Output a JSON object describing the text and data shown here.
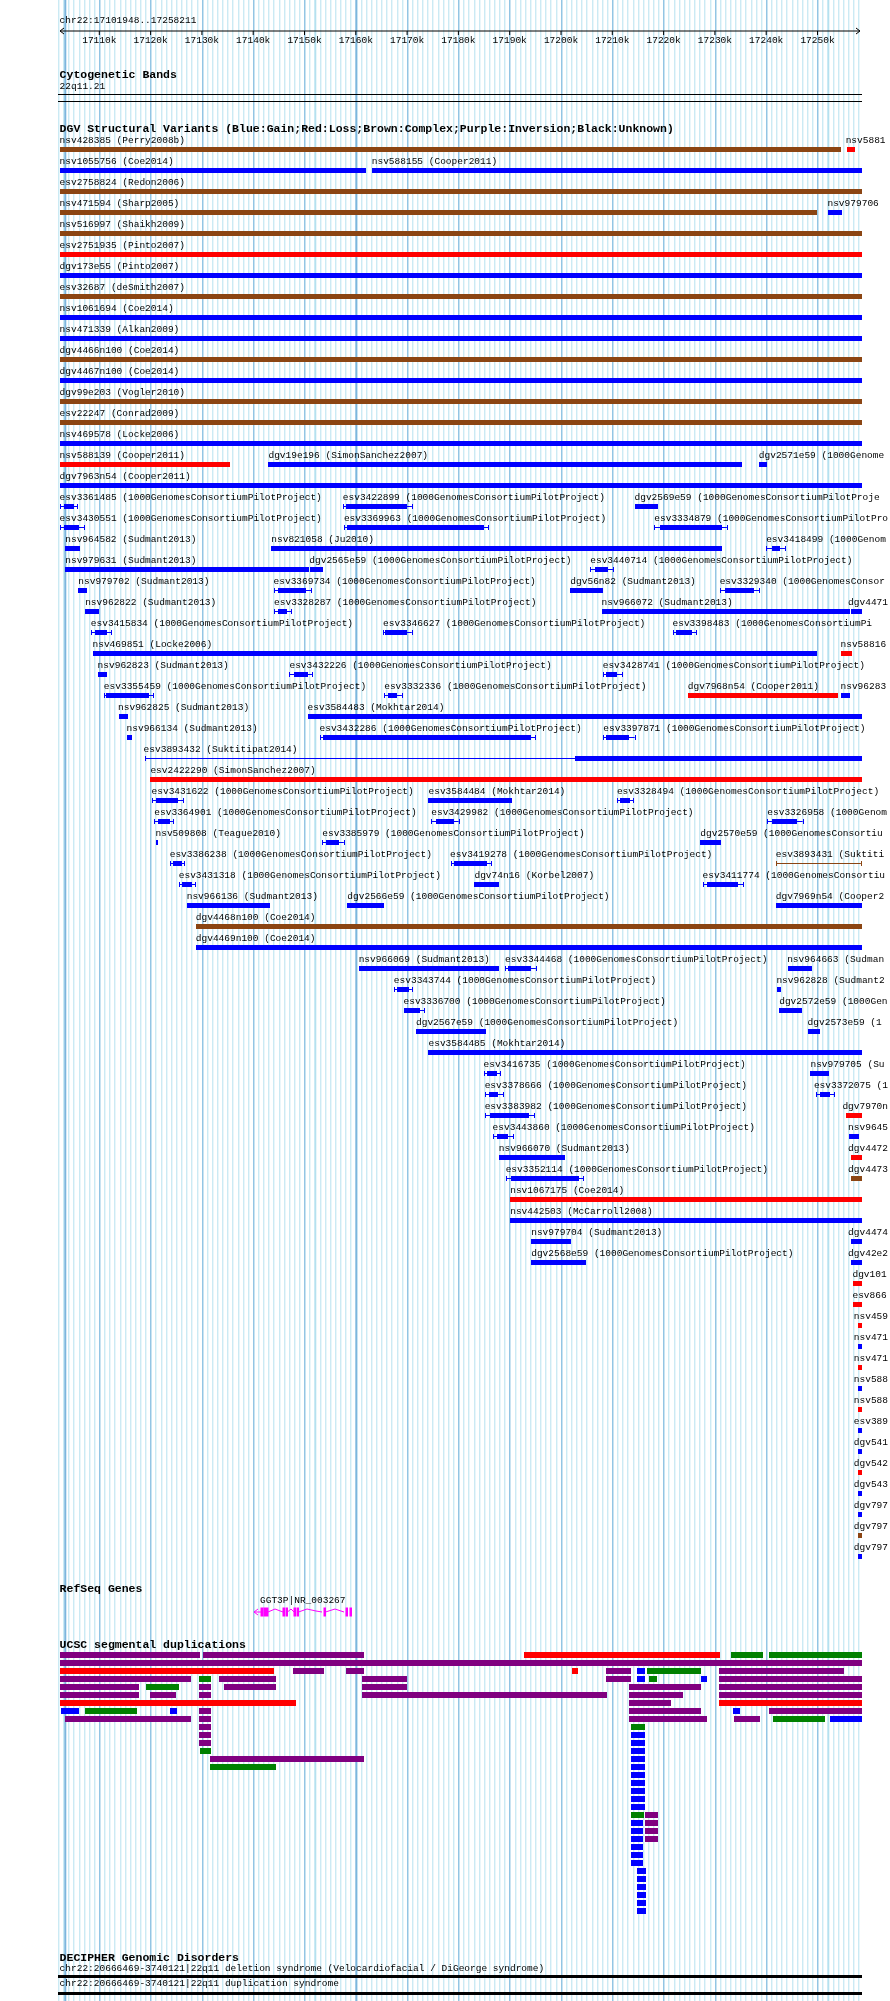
{
  "ruler": {
    "position": "chr22:17101948..17258211",
    "ticks": [
      "17110k",
      "17120k",
      "17130k",
      "17140k",
      "17150k",
      "17160k",
      "17170k",
      "17180k",
      "17190k",
      "17200k",
      "17210k",
      "17220k",
      "17230k",
      "17240k",
      "17250k"
    ]
  },
  "cytogenetic_bands": {
    "title": "Cytogenetic Bands",
    "band": "22q11.21"
  },
  "dgv": {
    "title": "DGV Structural Variants (Blue:Gain;Red:Loss;Brown:Complex;Purple:Inversion;Black:Unknown)",
    "rows": [
      [
        {
          "label": "nsv428385 (Perry2008b)",
          "color": "#8b4513",
          "kind": "bar"
        },
        {
          "label": "nsv5881",
          "color": "#ff0000",
          "kind": "bar"
        }
      ],
      [
        {
          "label": "nsv1055756 (Coe2014)",
          "color": "#0000ff",
          "kind": "bar"
        },
        {
          "label": "nsv588155 (Cooper2011)",
          "color": "#0000ff",
          "kind": "bar"
        }
      ],
      [
        {
          "label": "esv2758824 (Redon2006)",
          "color": "#8b4513",
          "kind": "bar"
        }
      ],
      [
        {
          "label": "nsv471594 (Sharp2005)",
          "color": "#8b4513",
          "kind": "bar"
        },
        {
          "label": "nsv979706",
          "color": "#0000ff",
          "kind": "bar"
        }
      ],
      [
        {
          "label": "nsv516997 (Shaikh2009)",
          "color": "#8b4513",
          "kind": "bar"
        }
      ],
      [
        {
          "label": "esv2751935 (Pinto2007)",
          "color": "#ff0000",
          "kind": "bar"
        }
      ],
      [
        {
          "label": "dgv173e55 (Pinto2007)",
          "color": "#0000ff",
          "kind": "bar"
        }
      ],
      [
        {
          "label": "esv32687 (deSmith2007)",
          "color": "#8b4513",
          "kind": "bar"
        }
      ],
      [
        {
          "label": "nsv1061694 (Coe2014)",
          "color": "#0000ff",
          "kind": "bar"
        }
      ],
      [
        {
          "label": "nsv471339 (Alkan2009)",
          "color": "#0000ff",
          "kind": "bar"
        }
      ],
      [
        {
          "label": "dgv4466n100 (Coe2014)",
          "color": "#8b4513",
          "kind": "bar"
        }
      ],
      [
        {
          "label": "dgv4467n100 (Coe2014)",
          "color": "#0000ff",
          "kind": "bar"
        }
      ],
      [
        {
          "label": "dgv99e203 (Vogler2010)",
          "color": "#8b4513",
          "kind": "bar"
        }
      ],
      [
        {
          "label": "esv22247 (Conrad2009)",
          "color": "#8b4513",
          "kind": "bar"
        }
      ],
      [
        {
          "label": "nsv469578 (Locke2006)",
          "color": "#0000ff",
          "kind": "bar"
        }
      ],
      [
        {
          "label": "nsv588139 (Cooper2011)",
          "color": "#ff0000",
          "kind": "bar"
        },
        {
          "label": "dgv19e196 (SimonSanchez2007)",
          "color": "#0000ff",
          "kind": "bar"
        },
        {
          "label": "dgv2571e59 (1000Genome",
          "color": "#0000ff",
          "kind": "bar"
        }
      ],
      [
        {
          "label": "dgv7963n54 (Cooper2011)",
          "color": "#0000ff",
          "kind": "bar"
        }
      ],
      [
        {
          "label": "esv3361485 (1000GenomesConsortiumPilotProject)",
          "color": "#0000ff",
          "kind": "span"
        },
        {
          "label": "esv3422899 (1000GenomesConsortiumPilotProject)",
          "color": "#0000ff",
          "kind": "span"
        },
        {
          "label": "dgv2569e59 (1000GenomesConsortiumPilotProje",
          "color": "#0000ff",
          "kind": "bar"
        }
      ],
      [
        {
          "label": "esv3430551 (1000GenomesConsortiumPilotProject)",
          "color": "#0000ff",
          "kind": "span"
        },
        {
          "label": "esv3369963 (1000GenomesConsortiumPilotProject)",
          "color": "#0000ff",
          "kind": "span"
        },
        {
          "label": "esv3334879 (1000GenomesConsortiumPilotPro",
          "color": "#0000ff",
          "kind": "span"
        }
      ],
      [
        {
          "label": "nsv964582 (Sudmant2013)",
          "color": "#0000ff",
          "kind": "bar"
        },
        {
          "label": "nsv821058 (Ju2010)",
          "color": "#0000ff",
          "kind": "bar"
        },
        {
          "label": "esv3418499 (1000Genom",
          "color": "#0000ff",
          "kind": "span"
        }
      ],
      [
        {
          "label": "nsv979631 (Sudmant2013)",
          "color": "#0000ff",
          "kind": "bar"
        },
        {
          "label": "dgv2565e59 (1000GenomesConsortiumPilotProject)",
          "color": "#0000ff",
          "kind": "bar"
        },
        {
          "label": "esv3440714 (1000GenomesConsortiumPilotProject)",
          "color": "#0000ff",
          "kind": "span"
        }
      ],
      [
        {
          "label": "nsv979702 (Sudmant2013)",
          "color": "#0000ff",
          "kind": "bar"
        },
        {
          "label": "esv3369734 (1000GenomesConsortiumPilotProject)",
          "color": "#0000ff",
          "kind": "span"
        },
        {
          "label": "dgv56n82 (Sudmant2013)",
          "color": "#0000ff",
          "kind": "bar"
        },
        {
          "label": "esv3329340 (1000GenomesConsor",
          "color": "#0000ff",
          "kind": "span"
        }
      ],
      [
        {
          "label": "nsv962822 (Sudmant2013)",
          "color": "#0000ff",
          "kind": "bar"
        },
        {
          "label": "esv3328287 (1000GenomesConsortiumPilotProject)",
          "color": "#0000ff",
          "kind": "span"
        },
        {
          "label": "nsv966072 (Sudmant2013)",
          "color": "#0000ff",
          "kind": "bar"
        },
        {
          "label": "dgv4471",
          "color": "#0000ff",
          "kind": "bar"
        }
      ],
      [
        {
          "label": "esv3415834 (1000GenomesConsortiumPilotProject)",
          "color": "#0000ff",
          "kind": "span"
        },
        {
          "label": "esv3346627 (1000GenomesConsortiumPilotProject)",
          "color": "#0000ff",
          "kind": "span"
        },
        {
          "label": "esv3398483 (1000GenomesConsortiumPi",
          "color": "#0000ff",
          "kind": "span"
        }
      ],
      [
        {
          "label": "nsv469851 (Locke2006)",
          "color": "#0000ff",
          "kind": "bar"
        },
        {
          "label": "nsv58816",
          "color": "#ff0000",
          "kind": "bar"
        }
      ],
      [
        {
          "label": "nsv962823 (Sudmant2013)",
          "color": "#0000ff",
          "kind": "bar"
        },
        {
          "label": "esv3432226 (1000GenomesConsortiumPilotProject)",
          "color": "#0000ff",
          "kind": "span"
        },
        {
          "label": "esv3428741 (1000GenomesConsortiumPilotProject)",
          "color": "#0000ff",
          "kind": "span"
        }
      ],
      [
        {
          "label": "esv3355459 (1000GenomesConsortiumPilotProject)",
          "color": "#0000ff",
          "kind": "span"
        },
        {
          "label": "esv3332336 (1000GenomesConsortiumPilotProject)",
          "color": "#0000ff",
          "kind": "span"
        },
        {
          "label": "dgv7968n54 (Cooper2011)",
          "color": "#ff0000",
          "kind": "bar"
        },
        {
          "label": "nsv96283",
          "color": "#0000ff",
          "kind": "bar"
        }
      ],
      [
        {
          "label": "nsv962825 (Sudmant2013)",
          "color": "#0000ff",
          "kind": "bar"
        },
        {
          "label": "esv3584483 (Mokhtar2014)",
          "color": "#0000ff",
          "kind": "bar"
        }
      ],
      [
        {
          "label": "nsv966134 (Sudmant2013)",
          "color": "#0000ff",
          "kind": "bar"
        },
        {
          "label": "esv3432286 (1000GenomesConsortiumPilotProject)",
          "color": "#0000ff",
          "kind": "span"
        },
        {
          "label": "esv3397871 (1000GenomesConsortiumPilotProject)",
          "color": "#0000ff",
          "kind": "span"
        }
      ],
      [
        {
          "label": "esv3893432 (Suktitipat2014)",
          "color": "#0000ff",
          "kind": "span"
        }
      ],
      [
        {
          "label": "esv2422290 (SimonSanchez2007)",
          "color": "#ff0000",
          "kind": "bar"
        }
      ],
      [
        {
          "label": "esv3431622 (1000GenomesConsortiumPilotProject)",
          "color": "#0000ff",
          "kind": "span"
        },
        {
          "label": "esv3584484 (Mokhtar2014)",
          "color": "#0000ff",
          "kind": "bar"
        },
        {
          "label": "esv3328494 (1000GenomesConsortiumPilotProject)",
          "color": "#0000ff",
          "kind": "span"
        }
      ],
      [
        {
          "label": "esv3364901 (1000GenomesConsortiumPilotProject)",
          "color": "#0000ff",
          "kind": "span"
        },
        {
          "label": "esv3429982 (1000GenomesConsortiumPilotProject)",
          "color": "#0000ff",
          "kind": "span"
        },
        {
          "label": "esv3326958 (1000Genom",
          "color": "#0000ff",
          "kind": "span"
        }
      ],
      [
        {
          "label": "nsv509808 (Teague2010)",
          "color": "#0000ff",
          "kind": "bar"
        },
        {
          "label": "esv3385979 (1000GenomesConsortiumPilotProject)",
          "color": "#0000ff",
          "kind": "span"
        },
        {
          "label": "dgv2570e59 (1000GenomesConsortiu",
          "color": "#0000ff",
          "kind": "bar"
        }
      ],
      [
        {
          "label": "esv3386238 (1000GenomesConsortiumPilotProject)",
          "color": "#0000ff",
          "kind": "span"
        },
        {
          "label": "esv3419278 (1000GenomesConsortiumPilotProject)",
          "color": "#0000ff",
          "kind": "span"
        },
        {
          "label": "esv3893431 (Suktiti",
          "color": "#8b4513",
          "kind": "span"
        }
      ],
      [
        {
          "label": "esv3431318 (1000GenomesConsortiumPilotProject)",
          "color": "#0000ff",
          "kind": "span"
        },
        {
          "label": "dgv74n16 (Korbel2007)",
          "color": "#0000ff",
          "kind": "bar"
        },
        {
          "label": "esv3411774 (1000GenomesConsortiu",
          "color": "#0000ff",
          "kind": "span"
        }
      ],
      [
        {
          "label": "nsv966136 (Sudmant2013)",
          "color": "#0000ff",
          "kind": "bar"
        },
        {
          "label": "dgv2566e59 (1000GenomesConsortiumPilotProject)",
          "color": "#0000ff",
          "kind": "bar"
        },
        {
          "label": "dgv7969n54 (Cooper2",
          "color": "#0000ff",
          "kind": "bar"
        }
      ],
      [
        {
          "label": "dgv4468n100 (Coe2014)",
          "color": "#8b4513",
          "kind": "bar"
        }
      ],
      [
        {
          "label": "dgv4469n100 (Coe2014)",
          "color": "#0000ff",
          "kind": "bar"
        }
      ],
      [
        {
          "label": "nsv966069 (Sudmant2013)",
          "color": "#0000ff",
          "kind": "bar"
        },
        {
          "label": "esv3344468 (1000GenomesConsortiumPilotProject)",
          "color": "#0000ff",
          "kind": "span"
        },
        {
          "label": "nsv964663 (Sudman",
          "color": "#0000ff",
          "kind": "bar"
        }
      ],
      [
        {
          "label": "esv3343744 (1000GenomesConsortiumPilotProject)",
          "color": "#0000ff",
          "kind": "span"
        },
        {
          "label": "nsv962828 (Sudmant2",
          "color": "#0000ff",
          "kind": "bar"
        }
      ],
      [
        {
          "label": "esv3336700 (1000GenomesConsortiumPilotProject)",
          "color": "#0000ff",
          "kind": "span"
        },
        {
          "label": "dgv2572e59 (1000Gen",
          "color": "#0000ff",
          "kind": "bar"
        }
      ],
      [
        {
          "label": "dgv2567e59 (1000GenomesConsortiumPilotProject)",
          "color": "#0000ff",
          "kind": "bar"
        },
        {
          "label": "dgv2573e59 (1",
          "color": "#0000ff",
          "kind": "bar"
        }
      ],
      [
        {
          "label": "esv3584485 (Mokhtar2014)",
          "color": "#0000ff",
          "kind": "bar"
        }
      ],
      [
        {
          "label": "esv3416735 (1000GenomesConsortiumPilotProject)",
          "color": "#0000ff",
          "kind": "span"
        },
        {
          "label": "nsv979705 (Su",
          "color": "#0000ff",
          "kind": "bar"
        }
      ],
      [
        {
          "label": "esv3378666 (1000GenomesConsortiumPilotProject)",
          "color": "#0000ff",
          "kind": "span"
        },
        {
          "label": "esv3372075 (1",
          "color": "#0000ff",
          "kind": "span"
        }
      ],
      [
        {
          "label": "esv3383982 (1000GenomesConsortiumPilotProject)",
          "color": "#0000ff",
          "kind": "span"
        },
        {
          "label": "dgv7970n",
          "color": "#ff0000",
          "kind": "bar"
        }
      ],
      [
        {
          "label": "esv3443860 (1000GenomesConsortiumPilotProject)",
          "color": "#0000ff",
          "kind": "span"
        },
        {
          "label": "nsv9645",
          "color": "#0000ff",
          "kind": "bar"
        }
      ],
      [
        {
          "label": "nsv966070 (Sudmant2013)",
          "color": "#0000ff",
          "kind": "bar"
        },
        {
          "label": "dgv4472",
          "color": "#ff0000",
          "kind": "bar"
        }
      ],
      [
        {
          "label": "esv3352114 (1000GenomesConsortiumPilotProject)",
          "color": "#0000ff",
          "kind": "span"
        },
        {
          "label": "dgv4473",
          "color": "#8b4513",
          "kind": "bar"
        }
      ],
      [
        {
          "label": "nsv1067175 (Coe2014)",
          "color": "#ff0000",
          "kind": "bar"
        }
      ],
      [
        {
          "label": "nsv442503 (McCarroll2008)",
          "color": "#0000ff",
          "kind": "bar"
        }
      ],
      [
        {
          "label": "nsv979704 (Sudmant2013)",
          "color": "#0000ff",
          "kind": "bar"
        },
        {
          "label": "dgv4474",
          "color": "#0000ff",
          "kind": "bar"
        }
      ],
      [
        {
          "label": "dgv2568e59 (1000GenomesConsortiumPilotProject)",
          "color": "#0000ff",
          "kind": "bar"
        },
        {
          "label": "dgv42e2",
          "color": "#0000ff",
          "kind": "bar"
        }
      ],
      [
        {
          "label": "dgv101",
          "color": "#ff0000",
          "kind": "bar"
        }
      ],
      [
        {
          "label": "esv866",
          "color": "#ff0000",
          "kind": "bar"
        }
      ],
      [
        {
          "label": "nsv459",
          "color": "#ff0000",
          "kind": "bar"
        }
      ],
      [
        {
          "label": "nsv471",
          "color": "#0000ff",
          "kind": "bar"
        }
      ],
      [
        {
          "label": "nsv471",
          "color": "#ff0000",
          "kind": "bar"
        }
      ],
      [
        {
          "label": "nsv588",
          "color": "#0000ff",
          "kind": "bar"
        }
      ],
      [
        {
          "label": "nsv588",
          "color": "#ff0000",
          "kind": "bar"
        }
      ],
      [
        {
          "label": "esv389",
          "color": "#0000ff",
          "kind": "bar"
        }
      ],
      [
        {
          "label": "dgv541",
          "color": "#0000ff",
          "kind": "bar"
        }
      ],
      [
        {
          "label": "dgv542",
          "color": "#ff0000",
          "kind": "bar"
        }
      ],
      [
        {
          "label": "dgv543",
          "color": "#0000ff",
          "kind": "bar"
        }
      ],
      [
        {
          "label": "dgv797",
          "color": "#0000ff",
          "kind": "bar"
        }
      ],
      [
        {
          "label": "dgv797",
          "color": "#8b4513",
          "kind": "bar"
        }
      ],
      [
        {
          "label": "dgv797",
          "color": "#0000ff",
          "kind": "bar"
        }
      ]
    ]
  },
  "refseq": {
    "title": "RefSeq Genes",
    "genes": [
      {
        "label": "GGT3P|NR_003267"
      }
    ]
  },
  "segdups": {
    "title": "UCSC segmental duplications",
    "rows": [
      [
        {
          "color": "#800080"
        },
        {
          "color": "#800080"
        },
        {
          "color": "#ff0000"
        },
        {
          "color": "#008000"
        },
        {
          "color": "#008000"
        }
      ],
      [
        {
          "color": "#800080"
        }
      ],
      [
        {
          "color": "#ff0000"
        },
        {
          "color": "#800080"
        },
        {
          "color": "#800080"
        },
        {
          "color": "#ff0000"
        },
        {
          "color": "#800080"
        },
        {
          "color": "#0000ff"
        },
        {
          "color": "#008000"
        },
        {
          "color": "#800080"
        }
      ],
      [
        {
          "color": "#800080"
        },
        {
          "color": "#008000"
        },
        {
          "color": "#800080"
        },
        {
          "color": "#800080"
        },
        {
          "color": "#800080"
        },
        {
          "color": "#0000ff"
        },
        {
          "color": "#008000"
        },
        {
          "color": "#0000ff"
        },
        {
          "color": "#800080"
        }
      ],
      [
        {
          "color": "#800080"
        },
        {
          "color": "#008000"
        },
        {
          "color": "#800080"
        },
        {
          "color": "#800080"
        },
        {
          "color": "#800080"
        },
        {
          "color": "#800080"
        },
        {
          "color": "#800080"
        }
      ],
      [
        {
          "color": "#800080"
        },
        {
          "color": "#800080"
        },
        {
          "color": "#800080"
        },
        {
          "color": "#800080"
        },
        {
          "color": "#800080"
        },
        {
          "color": "#800080"
        }
      ],
      [
        {
          "color": "#ff0000"
        },
        {
          "color": "#800080"
        },
        {
          "color": "#ff0000"
        }
      ],
      [
        {
          "color": "#0000ff"
        },
        {
          "color": "#008000"
        },
        {
          "color": "#0000ff"
        },
        {
          "color": "#800080"
        },
        {
          "color": "#800080"
        },
        {
          "color": "#0000ff"
        },
        {
          "color": "#800080"
        }
      ],
      [
        {
          "color": "#800080"
        },
        {
          "color": "#800080"
        },
        {
          "color": "#800080"
        },
        {
          "color": "#800080"
        },
        {
          "color": "#008000"
        },
        {
          "color": "#0000ff"
        }
      ],
      [
        {
          "color": "#800080"
        },
        {
          "color": "#008000"
        }
      ],
      [
        {
          "color": "#800080"
        },
        {
          "color": "#0000ff"
        }
      ],
      [
        {
          "color": "#800080"
        },
        {
          "color": "#0000ff"
        }
      ],
      [
        {
          "color": "#008000"
        },
        {
          "color": "#0000ff"
        }
      ],
      [
        {
          "color": "#800080"
        },
        {
          "color": "#0000ff"
        }
      ],
      [
        {
          "color": "#008000"
        },
        {
          "color": "#0000ff"
        }
      ],
      [
        {
          "color": "#0000ff"
        }
      ],
      [
        {
          "color": "#0000ff"
        }
      ],
      [
        {
          "color": "#0000ff"
        }
      ],
      [
        {
          "color": "#0000ff"
        }
      ],
      [
        {
          "color": "#0000ff"
        }
      ],
      [
        {
          "color": "#008000"
        },
        {
          "color": "#800080"
        }
      ],
      [
        {
          "color": "#0000ff"
        },
        {
          "color": "#800080"
        }
      ],
      [
        {
          "color": "#0000ff"
        },
        {
          "color": "#800080"
        }
      ],
      [
        {
          "color": "#0000ff"
        },
        {
          "color": "#800080"
        }
      ],
      [
        {
          "color": "#0000ff"
        }
      ],
      [
        {
          "color": "#0000ff"
        }
      ],
      [
        {
          "color": "#0000ff"
        }
      ],
      [
        {
          "color": "#0000ff"
        }
      ],
      [
        {
          "color": "#0000ff"
        }
      ],
      [
        {
          "color": "#0000ff"
        }
      ],
      [
        {
          "color": "#0000ff"
        }
      ],
      [
        {
          "color": "#0000ff"
        }
      ],
      [
        {
          "color": "#0000ff"
        }
      ]
    ]
  },
  "decipher": {
    "title": "DECIPHER Genomic Disorders",
    "items": [
      "chr22:20666469-3740121|22q11 deletion syndrome (Velocardiofacial / DiGeorge syndrome)",
      "chr22:20666469-3740121|22q11 duplication syndrome"
    ]
  }
}
